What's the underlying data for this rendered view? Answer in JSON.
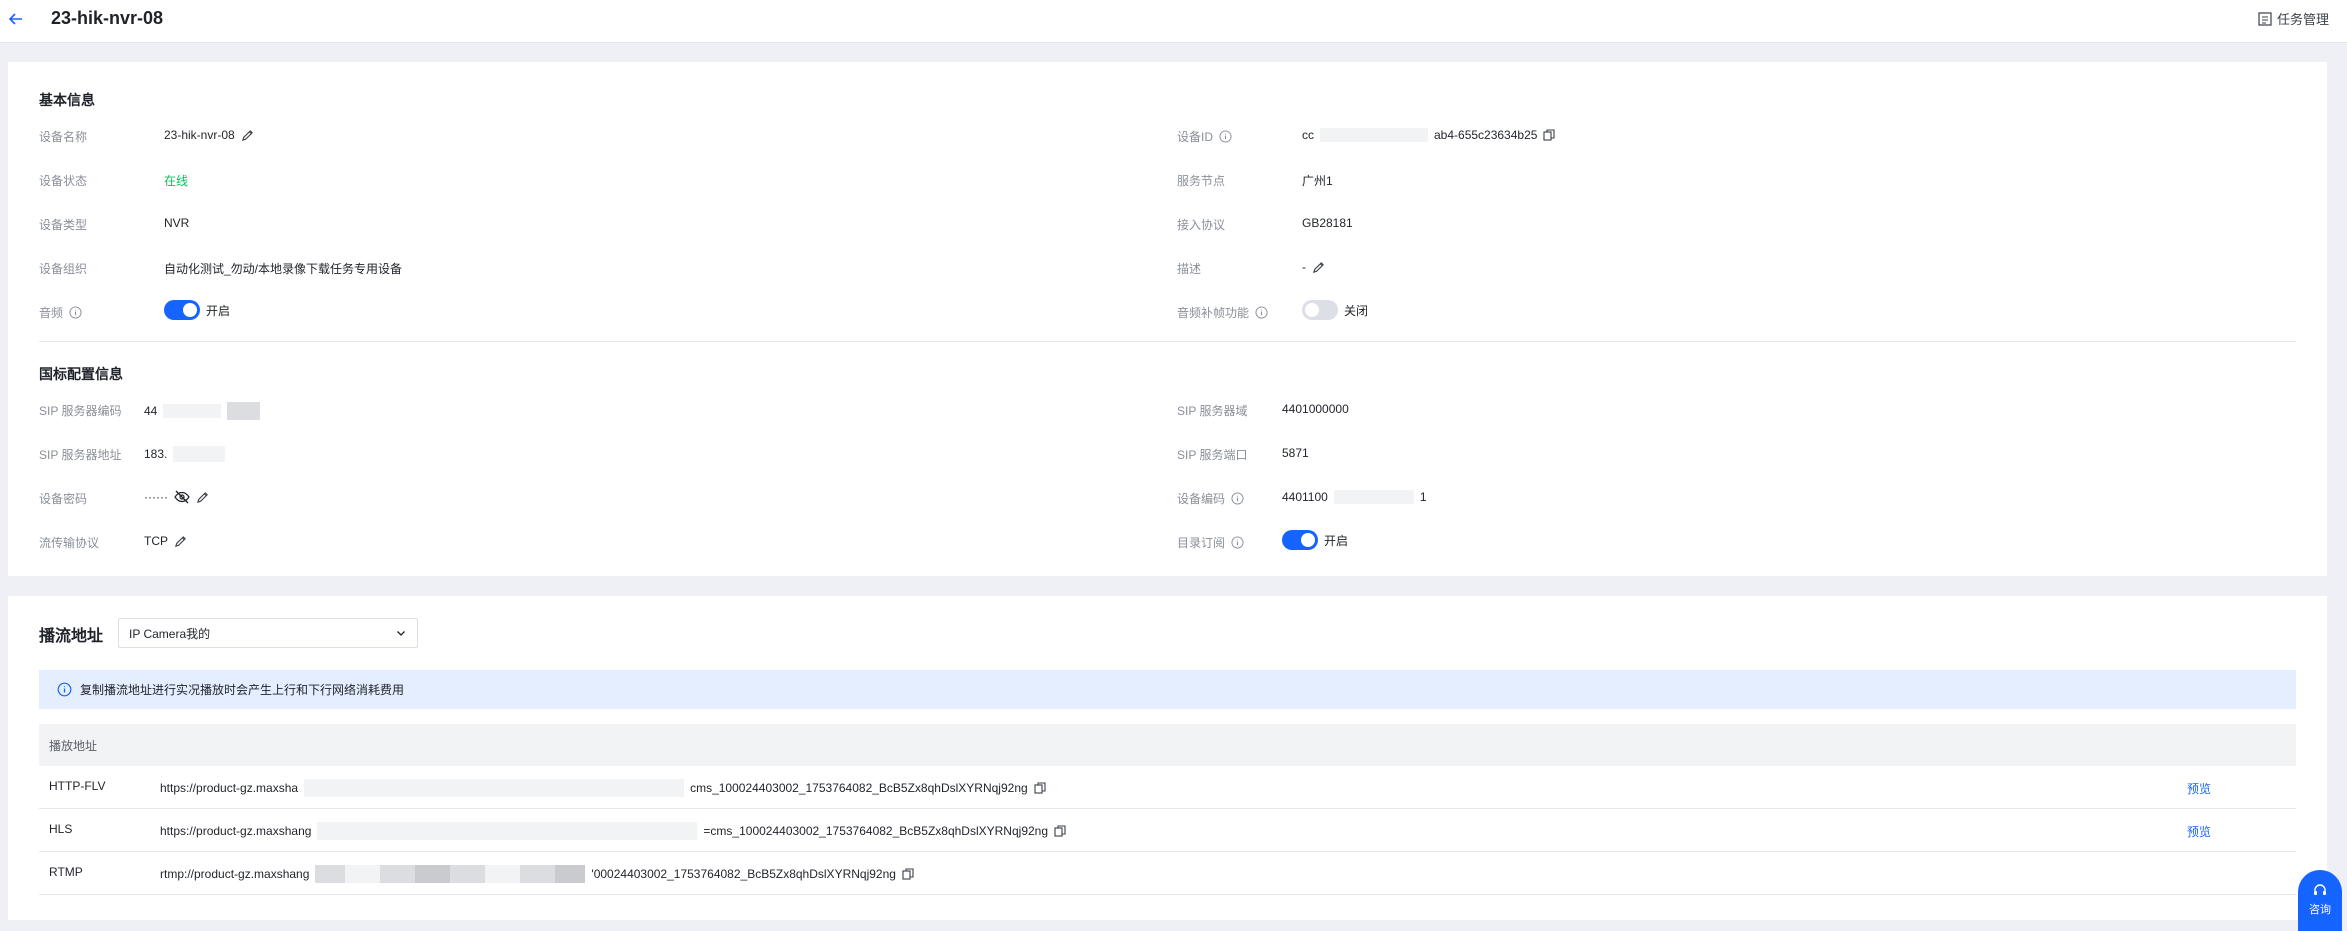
{
  "header": {
    "title": "23-hik-nvr-08",
    "task_mgmt_label": "任务管理"
  },
  "basic": {
    "section_title": "基本信息",
    "left": {
      "name_label": "设备名称",
      "name_value": "23-hik-nvr-08",
      "status_label": "设备状态",
      "status_value": "在线",
      "type_label": "设备类型",
      "type_value": "NVR",
      "org_label": "设备组织",
      "org_value": "自动化测试_勿动/本地录像下载任务专用设备",
      "audio_label": "音频",
      "audio_state": "开启"
    },
    "right": {
      "id_label": "设备ID",
      "id_value_start": "cc",
      "id_value_end": "ab4-655c23634b25",
      "node_label": "服务节点",
      "node_value": "广州1",
      "protocol_label": "接入协议",
      "protocol_value": "GB28181",
      "desc_label": "描述",
      "desc_value": "-",
      "audio_frame_label": "音频补帧功能",
      "audio_frame_state": "关闭"
    }
  },
  "gb": {
    "section_title": "国标配置信息",
    "left": {
      "sip_code_label": "SIP 服务器编码",
      "sip_code_value": "44",
      "sip_addr_label": "SIP 服务器地址",
      "sip_addr_value": "183.",
      "pwd_label": "设备密码",
      "pwd_value": "······",
      "transport_label": "流传输协议",
      "transport_value": "TCP"
    },
    "right": {
      "sip_domain_label": "SIP 服务器域",
      "sip_domain_value": "4401000000",
      "sip_port_label": "SIP 服务端口",
      "sip_port_value": "5871",
      "dev_code_label": "设备编码",
      "dev_code_start": "4401100",
      "dev_code_end": "1",
      "catalog_label": "目录订阅",
      "catalog_state": "开启"
    }
  },
  "stream": {
    "title": "播流地址",
    "select_value": "IP Camera我的",
    "notice": "复制播流地址进行实况播放时会产生上行和下行网络消耗费用",
    "table_header": "播放地址",
    "rows": [
      {
        "protocol": "HTTP-FLV",
        "url_start": "https://product-gz.maxsha",
        "url_end": "cms_100024403002_1753764082_BcB5Zx8qhDslXYRNqj92ng",
        "preview": "预览"
      },
      {
        "protocol": "HLS",
        "url_start": "https://product-gz.maxshang",
        "url_end": "=cms_100024403002_1753764082_BcB5Zx8qhDslXYRNqj92ng",
        "preview": "预览"
      },
      {
        "protocol": "RTMP",
        "url_start": "rtmp://product-gz.maxshang",
        "url_end": "'00024403002_1753764082_BcB5Zx8qhDslXYRNqj92ng",
        "preview": ""
      }
    ]
  },
  "consult_label": "咨询"
}
